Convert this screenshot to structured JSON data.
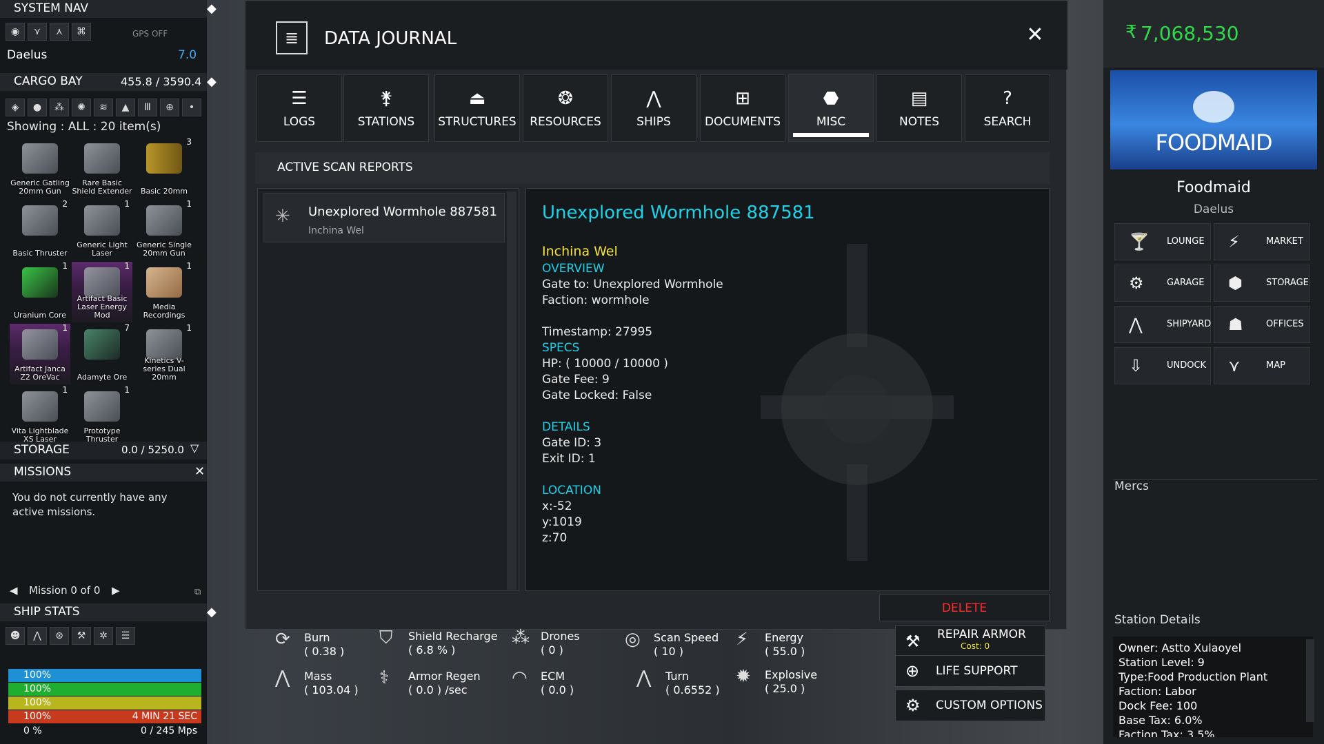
{
  "left": {
    "system_nav": {
      "title": "SYSTEM NAV",
      "gps": "GPS OFF",
      "system": "Daelus",
      "security": "7.0"
    },
    "cargo": {
      "title": "CARGO BAY",
      "capacity": "455.8 / 3590.4",
      "showing": "Showing : ALL : 20 item(s)"
    },
    "items": [
      {
        "name": "Generic Gatling 20mm Gun",
        "count": "",
        "purple": false
      },
      {
        "name": "Rare Basic Shield Extender",
        "count": "",
        "purple": false
      },
      {
        "name": "Basic 20mm",
        "count": "3",
        "purple": false
      },
      {
        "name": "Basic Thruster",
        "count": "2",
        "purple": false
      },
      {
        "name": "Generic Light Laser",
        "count": "1",
        "purple": false
      },
      {
        "name": "Generic Single 20mm Gun",
        "count": "1",
        "purple": false
      },
      {
        "name": "Uranium Core",
        "count": "1",
        "purple": false
      },
      {
        "name": "Artifact Basic Laser Energy Mod",
        "count": "1",
        "purple": true
      },
      {
        "name": "Media Recordings",
        "count": "1",
        "purple": false
      },
      {
        "name": "Artifact Janca Z2 OreVac",
        "count": "1",
        "purple": true
      },
      {
        "name": "Adamyte Ore",
        "count": "7",
        "purple": false
      },
      {
        "name": "Kinetics V-series Dual 20mm",
        "count": "1",
        "purple": false
      },
      {
        "name": "Vita Lightblade XS Laser",
        "count": "1",
        "purple": false
      },
      {
        "name": "Prototype Thruster",
        "count": "1",
        "purple": false
      }
    ],
    "storage": {
      "title": "STORAGE",
      "value": "0.0 / 5250.0"
    },
    "missions": {
      "title": "MISSIONS",
      "text": "You do not currently have any active missions.",
      "pager": "Mission 0 of 0"
    },
    "ship_stats": {
      "title": "SHIP STATS",
      "bars": [
        {
          "label": "100%",
          "right": "",
          "color": "#1e90d6"
        },
        {
          "label": "100%",
          "right": "",
          "color": "#1fae2f"
        },
        {
          "label": "100%",
          "right": "",
          "color": "#b8b61e"
        },
        {
          "label": "100%",
          "right": "4 MIN 21 SEC",
          "color": "#c83a1e"
        },
        {
          "label": "0 %",
          "right": "0 / 245 Mps",
          "color": "#15181b"
        }
      ]
    }
  },
  "journal": {
    "title": "DATA JOURNAL",
    "tabs": [
      "LOGS",
      "STATIONS",
      "STRUCTURES",
      "RESOURCES",
      "SHIPS",
      "DOCUMENTS",
      "MISC",
      "NOTES",
      "SEARCH"
    ],
    "section": "ACTIVE SCAN REPORTS",
    "report": {
      "name": "Unexplored Wormhole 887581",
      "system": "Inchina Wel"
    },
    "detail": {
      "title": "Unexplored Wormhole 887581",
      "system": "Inchina Wel",
      "overview_h": "OVERVIEW",
      "gate_to": "Gate to: Unexplored Wormhole",
      "faction": "Faction: wormhole",
      "timestamp": "Timestamp: 27995",
      "specs_h": "SPECS",
      "hp": "HP: ( 10000 / 10000 )",
      "fee": "Gate Fee: 9",
      "locked": "Gate Locked: False",
      "details_h": "DETAILS",
      "gate_id": "Gate ID: 3",
      "exit_id": "Exit ID: 1",
      "location_h": "LOCATION",
      "x": "x:-52",
      "y": "y:1019",
      "z": "z:70"
    },
    "delete": "DELETE"
  },
  "stats": {
    "burn": {
      "label": "Burn",
      "value": "( 0.38 )"
    },
    "mass": {
      "label": "Mass",
      "value": "( 103.04 )"
    },
    "shield": {
      "label": "Shield Recharge",
      "value": "( 6.8 % )"
    },
    "armor": {
      "label": "Armor Regen",
      "value": "( 0.0 ) /sec"
    },
    "drones": {
      "label": "Drones",
      "value": "( 0 )"
    },
    "ecm": {
      "label": "ECM",
      "value": "( 0.0 )"
    },
    "scan": {
      "label": "Scan Speed",
      "value": "( 10 )"
    },
    "turn": {
      "label": "Turn",
      "value": "( 0.6552 )"
    },
    "energy": {
      "label": "Energy",
      "value": "( 55.0 )"
    },
    "explosive": {
      "label": "Explosive",
      "value": "( 25.0 )"
    }
  },
  "actions": {
    "repair": "REPAIR ARMOR",
    "repair_cost": "Cost: 0",
    "life": "LIFE SUPPORT",
    "custom": "CUSTOM OPTIONS"
  },
  "right": {
    "credits": "7,068,530",
    "logo": "FOODMAID",
    "station": "Foodmaid",
    "system": "Daelus",
    "buttons": [
      "LOUNGE",
      "MARKET",
      "GARAGE",
      "STORAGE",
      "SHIPYARD",
      "OFFICES",
      "UNDOCK",
      "MAP"
    ],
    "mercs": "Mercs",
    "details_h": "Station Details",
    "details": [
      "Owner: Astto Xulaoyel",
      "Station Level: 9",
      "Type:Food Production Plant",
      "Faction: Labor",
      "Dock Fee: 100",
      "Base Tax: 6.0%",
      "Faction Tax: 3.5%"
    ]
  }
}
